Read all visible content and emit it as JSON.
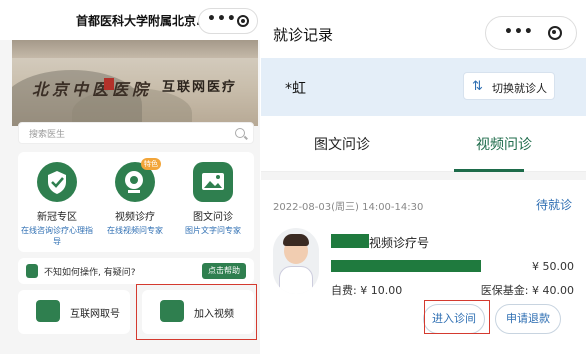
{
  "left": {
    "title": "首都医科大学附属北京...",
    "capsule_dots": "•••",
    "banner": {
      "brush_text": "北京中医医院",
      "brand_text": "互联网医疗"
    },
    "search_placeholder": "搜索医生",
    "services": [
      {
        "title": "新冠专区",
        "subtitle": "在线咨询诊疗心理指导",
        "icon": "shield-check-icon"
      },
      {
        "title": "视频诊疗",
        "subtitle": "在线视频问专家",
        "icon": "video-consult-icon",
        "badge": "特色"
      },
      {
        "title": "图文问诊",
        "subtitle": "图片文字问专家",
        "icon": "image-chat-icon"
      }
    ],
    "help": {
      "text": "不知如何操作, 有疑问?",
      "button": "点击帮助"
    },
    "tiles": [
      {
        "label": "互联网取号",
        "icon": "ticket-icon"
      },
      {
        "label": "加入视频",
        "icon": "video-join-icon"
      }
    ]
  },
  "right": {
    "title": "就诊记录",
    "capsule_dots": "•••",
    "patient_name": "*虹",
    "switch_label": "切换就诊人",
    "tabs": [
      "图文问诊",
      "视频问诊"
    ],
    "active_tab": 1,
    "card": {
      "datetime": "2022-08-03(周三) 14:00-14:30",
      "status": "待就诊",
      "doctor_title": "视频诊疗号",
      "price": "¥ 50.00",
      "self_pay": "自费: ¥ 10.00",
      "insurance": "医保基金: ¥ 40.00",
      "enter_button": "进入诊间",
      "refund_button": "申请退款"
    }
  },
  "colors": {
    "brand_green": "#2f7f4f",
    "link_blue": "#2f6fb3",
    "highlight_red": "#d43a2f",
    "patient_bar": "#e4eef8"
  }
}
